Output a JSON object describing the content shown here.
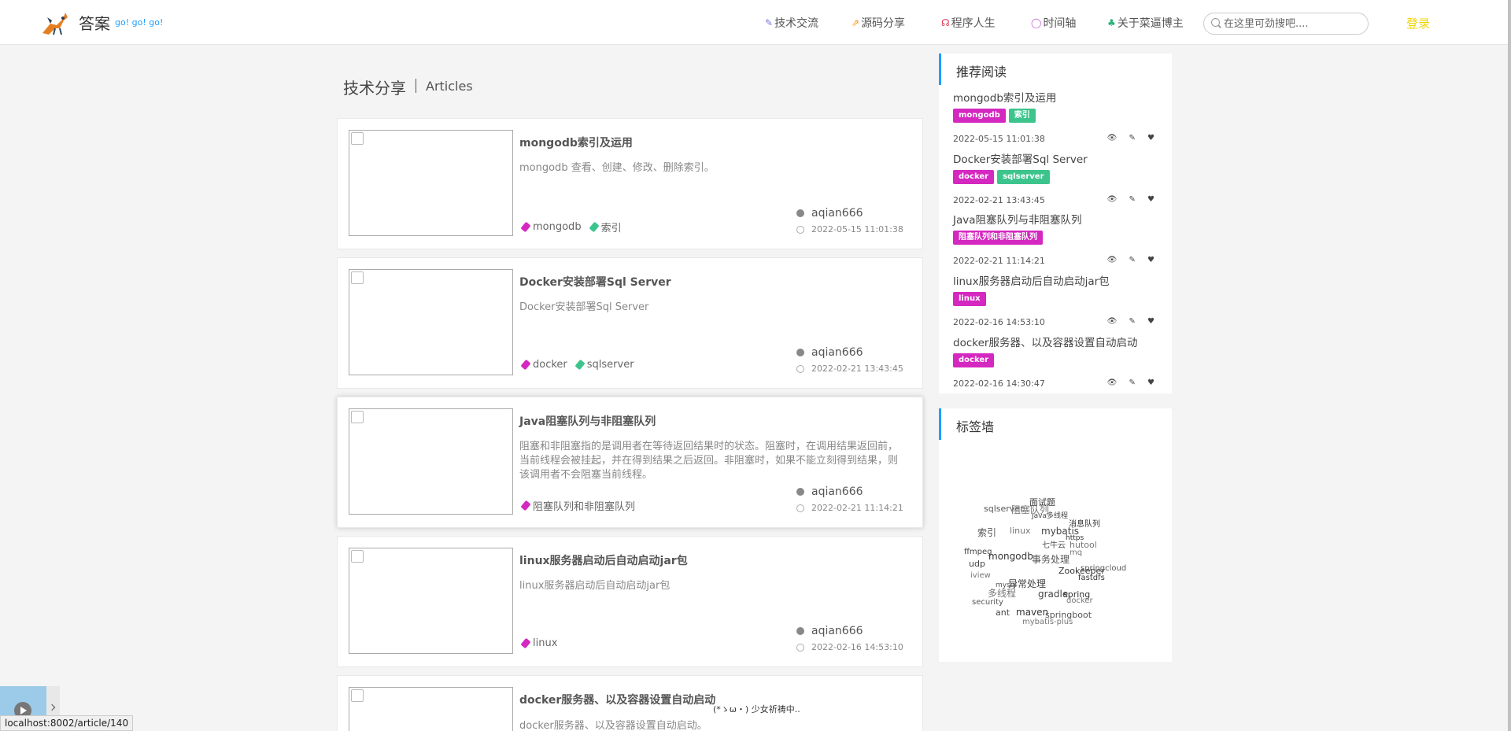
{
  "header": {
    "logo_icon": "deer-logo-icon",
    "logo_text": "答案",
    "logo_sub": "go! go! go!",
    "nav": [
      {
        "label": "技术交流",
        "icon": "feather-icon",
        "color": "#7a7ad8"
      },
      {
        "label": "源码分享",
        "icon": "share-icon",
        "color": "#ff8c00"
      },
      {
        "label": "程序人生",
        "icon": "headphones-icon",
        "color": "#e0304f"
      },
      {
        "label": "时间轴",
        "icon": "circle-icon",
        "color": "#c060d0"
      },
      {
        "label": "关于菜逼博主",
        "icon": "leaf-icon",
        "color": "#2ab27b"
      }
    ],
    "search_placeholder": "在这里可劲搜吧....",
    "login": "登录"
  },
  "section": {
    "title": "技术分享",
    "subtitle": "Articles"
  },
  "articles": [
    {
      "title": "mongodb索引及运用",
      "desc": "mongodb 查看、创建、修改、删除索引。",
      "tags": [
        {
          "label": "mongodb",
          "color": "#d428c0"
        },
        {
          "label": "索引",
          "color": "#3cc48c"
        }
      ],
      "author": "aqian666",
      "date": "2022-05-15 11:01:38"
    },
    {
      "title": "Docker安装部署Sql Server",
      "desc": "Docker安装部署Sql Server",
      "tags": [
        {
          "label": "docker",
          "color": "#d428c0"
        },
        {
          "label": "sqlserver",
          "color": "#3cc48c"
        }
      ],
      "author": "aqian666",
      "date": "2022-02-21 13:43:45"
    },
    {
      "title": "Java阻塞队列与非阻塞队列",
      "desc": "阻塞和非阻塞指的是调用者在等待返回结果时的状态。阻塞时，在调用结果返回前，当前线程会被挂起，并在得到结果之后返回。非阻塞时，如果不能立刻得到结果，则该调用者不会阻塞当前线程。",
      "tags": [
        {
          "label": "阻塞队列和非阻塞队列",
          "color": "#d428c0"
        }
      ],
      "author": "aqian666",
      "date": "2022-02-21 11:14:21"
    },
    {
      "title": "linux服务器启动后自动启动jar包",
      "desc": "linux服务器启动后自动启动jar包",
      "tags": [
        {
          "label": "linux",
          "color": "#d428c0"
        }
      ],
      "author": "aqian666",
      "date": "2022-02-16 14:53:10"
    },
    {
      "title": "docker服务器、以及容器设置自动启动",
      "desc": "docker服务器、以及容器设置自动启动。",
      "tags": [],
      "author": "",
      "date": ""
    }
  ],
  "recommend": {
    "title": "推荐阅读",
    "items": [
      {
        "title": "mongodb索引及运用",
        "tags": [
          {
            "label": "mongodb",
            "color": "#d428c0"
          },
          {
            "label": "索引",
            "color": "#3cc48c"
          }
        ],
        "date": "2022-05-15 11:01:38"
      },
      {
        "title": "Docker安装部署Sql Server",
        "tags": [
          {
            "label": "docker",
            "color": "#d428c0"
          },
          {
            "label": "sqlserver",
            "color": "#3cc48c"
          }
        ],
        "date": "2022-02-21 13:43:45"
      },
      {
        "title": "Java阻塞队列与非阻塞队列",
        "tags": [
          {
            "label": "阻塞队列和非阻塞队列",
            "color": "#d428c0"
          }
        ],
        "date": "2022-02-21 11:14:21"
      },
      {
        "title": "linux服务器启动后自动启动jar包",
        "tags": [
          {
            "label": "linux",
            "color": "#d428c0"
          }
        ],
        "date": "2022-02-16 14:53:10"
      },
      {
        "title": "docker服务器、以及容器设置自动启动",
        "tags": [
          {
            "label": "docker",
            "color": "#d428c0"
          }
        ],
        "date": "2022-02-16 14:30:47"
      }
    ],
    "meta_icons": "👁 ✎ ♥"
  },
  "tagwall": {
    "title": "标签墙",
    "words": [
      "面试题",
      "sqlserver",
      "阻塞队列",
      "Java多线程",
      "消息队列",
      "索引",
      "linux",
      "mybatis",
      "https",
      "七牛云",
      "hutool",
      "ffmpeg",
      "mongodb",
      "事务处理",
      "mq",
      "udp",
      "Zookeeper",
      "springcloud",
      "iview",
      "异常处理",
      "fastdfs",
      "mysql",
      "多线程",
      "gradle",
      "spring",
      "security",
      "docker",
      "ant",
      "maven",
      "springboot",
      "mybatis-plus"
    ]
  },
  "float_text": "(*ゝω・) 少女祈祷中..",
  "status_url": "localhost:8002/article/140"
}
